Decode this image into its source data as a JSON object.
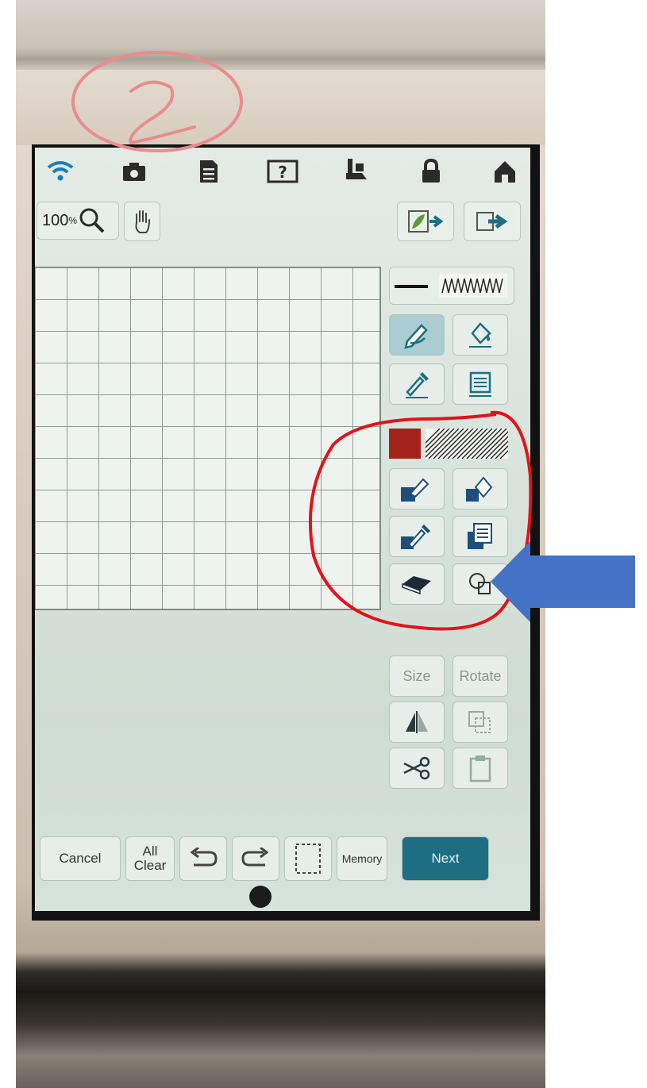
{
  "annotations": {
    "circled_number": "2",
    "ring_color": "#e98c8c",
    "highlight_color": "#e5121a",
    "arrow_color": "#4472c4"
  },
  "status_bar": {
    "icons": [
      "wifi-icon",
      "camera-icon",
      "document-icon",
      "help-icon",
      "presser-foot-icon",
      "lock-icon",
      "home-icon"
    ]
  },
  "toolbar": {
    "zoom_value": "100",
    "zoom_unit": "%",
    "import_label_icon": "leaf-import-icon",
    "export_label_icon": "export-icon"
  },
  "line_section": {
    "line_style_icon": "straight-line-swatch",
    "stitch_style_icon": "zigzag-stitch-swatch"
  },
  "fill_section": {
    "fill_color": "#a3231b",
    "pattern_icon": "hatch-pattern-swatch"
  },
  "edit_section": {
    "size_label": "Size",
    "rotate_label": "Rotate"
  },
  "bottom_bar": {
    "cancel_label": "Cancel",
    "all_label": "All",
    "clear_label": "Clear",
    "memory_label": "Memory",
    "next_label": "Next",
    "accent_color": "#1d6e83"
  }
}
